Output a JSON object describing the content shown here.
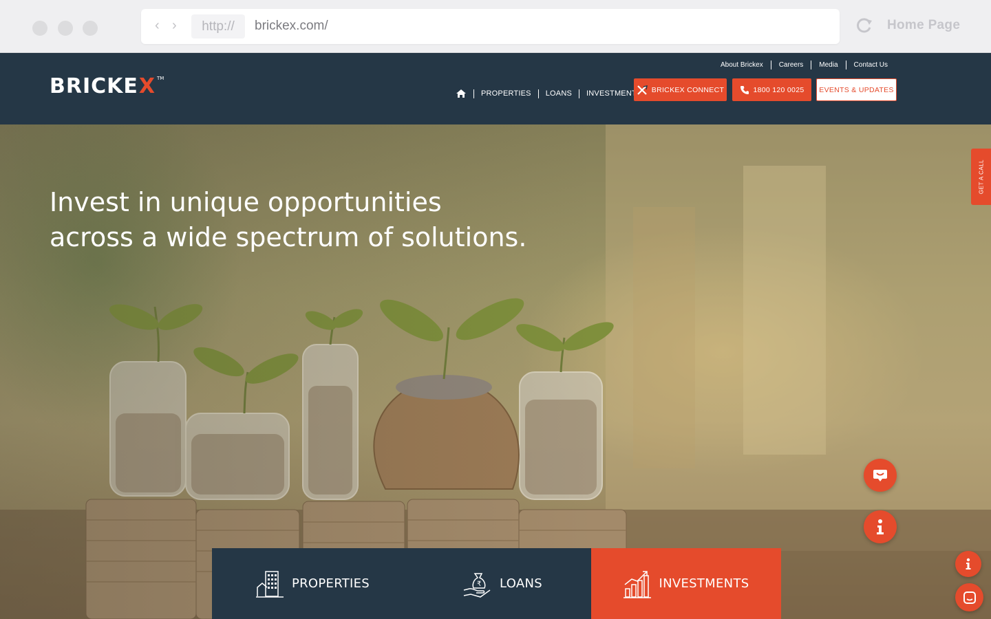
{
  "browser": {
    "protocol": "http://",
    "url": "brickex.com/",
    "home_label": "Home Page",
    "icons": [
      "back-icon",
      "forward-icon",
      "reload-icon"
    ]
  },
  "header": {
    "logo_main": "BRICKE",
    "logo_x": "X",
    "logo_tm": "TM",
    "top_links": [
      "About Brickex",
      "Careers",
      "Media",
      "Contact Us"
    ],
    "nav": [
      "PROPERTIES",
      "LOANS",
      "INVESTMENTS"
    ],
    "connect_label": "BRICKEX CONNECT",
    "phone_label": "1800 120 0025",
    "events_label": "EVENTS & UPDATES"
  },
  "hero": {
    "title_line1": "Invest in unique opportunities",
    "title_line2": "across a wide spectrum of solutions."
  },
  "side_tab": {
    "label": "GET A CALL"
  },
  "categories": [
    {
      "label": "PROPERTIES",
      "icon": "building-icon"
    },
    {
      "label": "LOANS",
      "icon": "money-bag-hand-icon"
    },
    {
      "label": "INVESTMENTS",
      "icon": "growth-chart-icon"
    }
  ],
  "colors": {
    "brand_red": "#e54b2c",
    "navy": "#253746"
  }
}
